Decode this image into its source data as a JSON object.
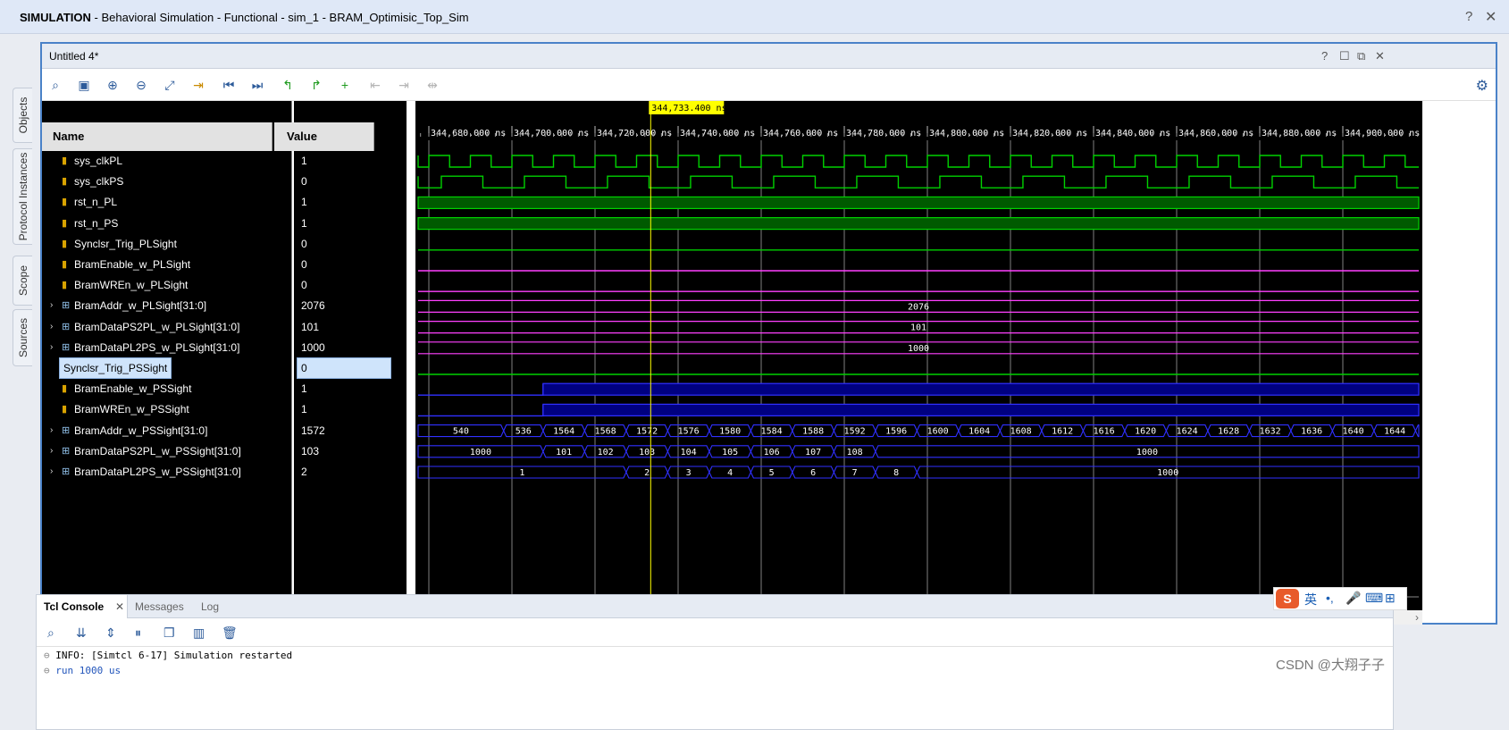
{
  "window": {
    "title_prefix": "SIMULATION",
    "title_rest": " - Behavioral Simulation - Functional - sim_1 - BRAM_Optimisic_Top_Sim",
    "help": "?",
    "close": "✕"
  },
  "side_tabs": [
    "Objects",
    "Protocol Instances",
    "Scope",
    "Sources"
  ],
  "wave_window": {
    "title": "Untitled 4*",
    "controls": [
      "?",
      "☐",
      "⧉",
      "✕"
    ],
    "cursor_label": "344,733.400 ns",
    "col_name": "Name",
    "col_value": "Value",
    "toolbar_icons": [
      "search-icon",
      "save-icon",
      "zoom-in-icon",
      "zoom-out-icon",
      "zoom-fit-icon",
      "goto-cursor-icon",
      "goto-start-icon",
      "goto-end-icon",
      "prev-transition-icon",
      "next-transition-icon",
      "add-marker-icon",
      "prev-marker-icon",
      "next-marker-icon",
      "swap-cursors-icon"
    ],
    "timeline_labels": [
      "344,680.000 ns",
      "344,700.000 ns",
      "344,720.000 ns",
      "344,740.000 ns",
      "344,760.000 ns",
      "344,780.000 ns",
      "344,800.000 ns",
      "344,820.000 ns",
      "344,840.000 ns",
      "344,860.000 ns",
      "344,880.000 ns",
      "344,900.000 ns"
    ],
    "signals": [
      {
        "name": "sys_clkPL",
        "value": "1",
        "kind": "bit",
        "icon": "logic-icon"
      },
      {
        "name": "sys_clkPS",
        "value": "0",
        "kind": "bit",
        "icon": "logic-icon"
      },
      {
        "name": "rst_n_PL",
        "value": "1",
        "kind": "bit",
        "icon": "logic-icon"
      },
      {
        "name": "rst_n_PS",
        "value": "1",
        "kind": "bit",
        "icon": "logic-icon"
      },
      {
        "name": "Synclsr_Trig_PLSight",
        "value": "0",
        "kind": "bit",
        "icon": "logic-icon"
      },
      {
        "name": "BramEnable_w_PLSight",
        "value": "0",
        "kind": "bit",
        "icon": "logic-icon"
      },
      {
        "name": "BramWREn_w_PLSight",
        "value": "0",
        "kind": "bit",
        "icon": "logic-icon"
      },
      {
        "name": "BramAddr_w_PLSight[31:0]",
        "value": "2076",
        "kind": "bus",
        "icon": "bus-icon"
      },
      {
        "name": "BramDataPS2PL_w_PLSight[31:0]",
        "value": "101",
        "kind": "bus",
        "icon": "bus-icon"
      },
      {
        "name": "BramDataPL2PS_w_PLSight[31:0]",
        "value": "1000",
        "kind": "bus",
        "icon": "bus-icon"
      },
      {
        "name": "Synclsr_Trig_PSSight",
        "value": "0",
        "kind": "bit",
        "icon": "logic-icon",
        "selected": true
      },
      {
        "name": "BramEnable_w_PSSight",
        "value": "1",
        "kind": "bit",
        "icon": "logic-icon"
      },
      {
        "name": "BramWREn_w_PSSight",
        "value": "1",
        "kind": "bit",
        "icon": "logic-icon"
      },
      {
        "name": "BramAddr_w_PSSight[31:0]",
        "value": "1572",
        "kind": "bus",
        "icon": "bus-icon"
      },
      {
        "name": "BramDataPS2PL_w_PSSight[31:0]",
        "value": "103",
        "kind": "bus",
        "icon": "bus-icon"
      },
      {
        "name": "BramDataPL2PS_w_PSSight[31:0]",
        "value": "2",
        "kind": "bus",
        "icon": "bus-icon"
      }
    ],
    "bus_labels": {
      "addr_pl": "2076",
      "ps2pl_pl": "101",
      "pl2ps_pl": "1000",
      "addr_ps": [
        "540",
        "536",
        "1564",
        "1568",
        "1572",
        "1576",
        "1580",
        "1584",
        "1588",
        "1592",
        "1596",
        "1600",
        "1604",
        "1608",
        "1612",
        "1616",
        "1620",
        "1624",
        "1628",
        "1632",
        "1636",
        "1640",
        "1644"
      ],
      "ps2pl_ps": [
        "1000",
        "101",
        "102",
        "103",
        "104",
        "105",
        "106",
        "107",
        "108",
        "1000"
      ],
      "pl2ps_ps": [
        "1",
        "2",
        "3",
        "4",
        "5",
        "6",
        "7",
        "8",
        "1000"
      ]
    },
    "colors": {
      "green": "#00d100",
      "green_fill": "#005a00",
      "magenta": "#ff40ff",
      "blue": "#3030ff",
      "blue_fill": "#000080",
      "cursor": "#ffff00",
      "grid": "#808080"
    }
  },
  "tcl": {
    "tabs": [
      "Tcl Console",
      "Messages",
      "Log"
    ],
    "close": "✕",
    "lines": [
      "INFO: [Simtcl 6-17] Simulation restarted",
      "run 1000 us"
    ]
  },
  "watermark": "CSDN @大翔子子",
  "ime": {
    "logo": "S",
    "lang": "英",
    "punct": "•,",
    "mic": "🎤",
    "kbd": "⌨",
    "grid": "⊞"
  }
}
